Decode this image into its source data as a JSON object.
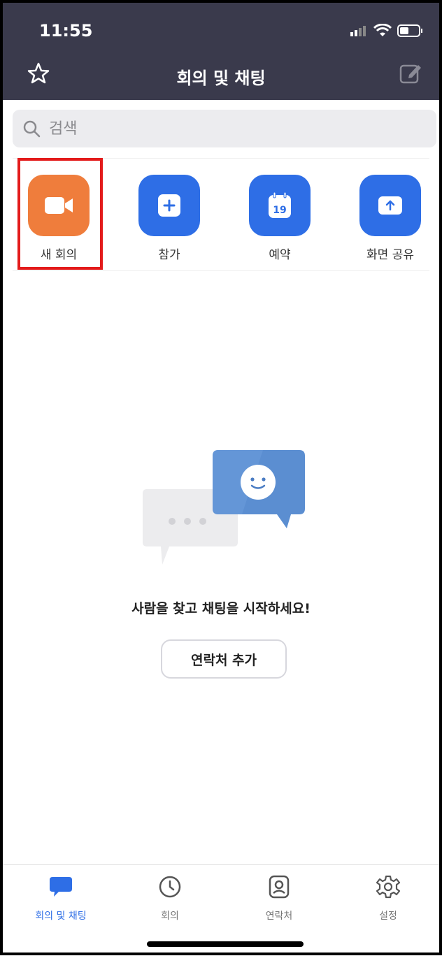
{
  "status_bar": {
    "time": "11:55"
  },
  "header": {
    "title": "회의 및 채팅",
    "left_icon": "star-icon",
    "right_icon": "compose-icon"
  },
  "search": {
    "placeholder": "검색"
  },
  "actions": [
    {
      "label": "새 회의",
      "icon": "video-camera-icon",
      "color": "#ef7d3c"
    },
    {
      "label": "참가",
      "icon": "plus-icon",
      "color": "#2e6ee6"
    },
    {
      "label": "예약",
      "icon": "calendar-icon",
      "color": "#2e6ee6",
      "calendar_day": "19"
    },
    {
      "label": "화면 공유",
      "icon": "share-up-arrow-icon",
      "color": "#2e6ee6"
    }
  ],
  "empty_state": {
    "message": "사람을 찾고 채팅을 시작하세요!",
    "button_label": "연락처 추가",
    "illustration": "chat-bubbles-illustration"
  },
  "tabs": [
    {
      "label": "회의 및 채팅",
      "icon": "chat-bubble-icon",
      "active": true
    },
    {
      "label": "회의",
      "icon": "clock-icon",
      "active": false
    },
    {
      "label": "연락처",
      "icon": "contacts-icon",
      "active": false
    },
    {
      "label": "설정",
      "icon": "gear-icon",
      "active": false
    }
  ],
  "colors": {
    "header_bg": "#3a3a4c",
    "accent_blue": "#2e6ee6",
    "new_meeting_orange": "#ef7d3c",
    "highlight_red": "#e31b1b"
  }
}
